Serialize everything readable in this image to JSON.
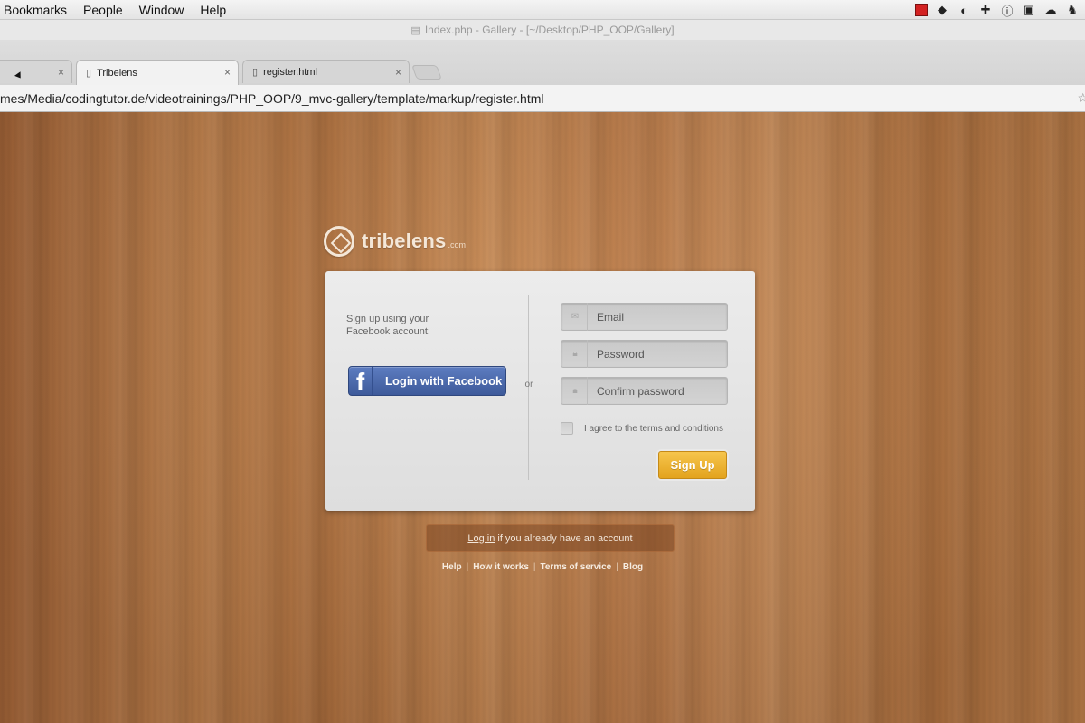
{
  "menubar": {
    "items": [
      "Bookmarks",
      "People",
      "Window",
      "Help"
    ],
    "tray_icons": [
      "record-icon",
      "dropbox-icon",
      "evernote-leaf-icon",
      "add-icon",
      "info-icon",
      "bookmark-icon",
      "cloud-icon",
      "evernote-icon"
    ]
  },
  "window": {
    "title": "Index.php - Gallery - [~/Desktop/PHP_OOP/Gallery]"
  },
  "tabs": [
    {
      "label": "",
      "close": "×"
    },
    {
      "label": "Tribelens",
      "close": "×"
    },
    {
      "label": "register.html",
      "close": "×"
    }
  ],
  "address": {
    "url": "mes/Media/codingtutor.de/videotrainings/PHP_OOP/9_mvc-gallery/template/markup/register.html"
  },
  "brand": {
    "name": "tribelens",
    "suffix": ".com"
  },
  "signup_form": {
    "facebook_intro_line1": "Sign up using your",
    "facebook_intro_line2": "Facebook account:",
    "facebook_button": "Login with Facebook",
    "facebook_glyph": "f",
    "divider_text": "or",
    "email_placeholder": "Email",
    "password_placeholder": "Password",
    "confirm_placeholder": "Confirm password",
    "agree_label": "I agree to the terms and conditions",
    "signup_button": "Sign Up"
  },
  "login_prompt": {
    "link": "Log in",
    "text": "if you already have an account"
  },
  "footer": {
    "links": [
      "Help",
      "How it works",
      "Terms of service",
      "Blog"
    ],
    "separator": "|"
  },
  "colors": {
    "facebook_blue": "#3e5a9a",
    "signup_orange": "#e3a31e",
    "wood": "#b8753f"
  }
}
